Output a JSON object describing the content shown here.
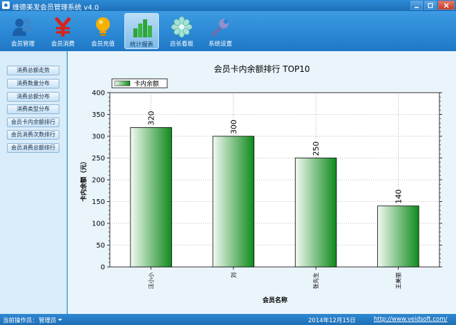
{
  "window": {
    "title": "维德美发会员管理系统 v4.0"
  },
  "toolbar": {
    "items": [
      {
        "label": "会员管理",
        "icon": "members-icon"
      },
      {
        "label": "会员消费",
        "icon": "yen-icon"
      },
      {
        "label": "会员充值",
        "icon": "lightbulb-icon"
      },
      {
        "label": "统计报表",
        "icon": "bar-chart-icon",
        "active": true
      },
      {
        "label": "店长看板",
        "icon": "flower-icon"
      },
      {
        "label": "系统设置",
        "icon": "wrench-icon"
      }
    ]
  },
  "sidebar": {
    "items": [
      {
        "label": "消费总额走势"
      },
      {
        "label": "消费数量分布"
      },
      {
        "label": "消费总额分布"
      },
      {
        "label": "消费类型分布"
      },
      {
        "label": "会员卡内余额排行"
      },
      {
        "label": "会员消费次数排行"
      },
      {
        "label": "会员消费总额排行"
      }
    ]
  },
  "chart_data": {
    "type": "bar",
    "title": "会员卡内余额排行 TOP10",
    "xlabel": "会员名称",
    "ylabel": "卡内余额（元）",
    "categories": [
      "汪小小",
      "刘",
      "张先生",
      "王美丽"
    ],
    "series": [
      {
        "name": "卡内余额",
        "values": [
          320,
          300,
          250,
          140
        ]
      }
    ],
    "ylim": [
      0,
      400
    ],
    "yticks": [
      0,
      50,
      100,
      150,
      200,
      250,
      300,
      350,
      400
    ],
    "grid": true,
    "legend": "top-left",
    "colors": {
      "bar_dark": "#0f8a1c",
      "bar_light": "#f2faf2"
    }
  },
  "statusbar": {
    "operator_label": "当前操作员：",
    "operator": "管理员",
    "date": "2014年12月15日",
    "url": "http://www.veidsoft.com/"
  }
}
